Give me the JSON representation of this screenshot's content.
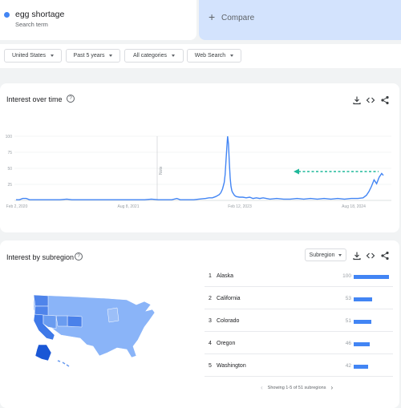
{
  "search": {
    "term": "egg shortage",
    "term_subtitle": "Search term",
    "term_color": "#4285f4",
    "compare_label": "Compare"
  },
  "filters": [
    {
      "label": "United States"
    },
    {
      "label": "Past 5 years"
    },
    {
      "label": "All categories"
    },
    {
      "label": "Web Search"
    }
  ],
  "interest_over_time": {
    "title": "Interest over time",
    "note_label": "Note"
  },
  "chart_data": {
    "type": "line",
    "x_tick_labels": [
      "Feb 2, 2020",
      "Aug 8, 2021",
      "Feb 12, 2023",
      "Aug 18, 2024"
    ],
    "y_tick_labels": [
      "100",
      "75",
      "50",
      "25"
    ],
    "ylim": [
      0,
      100
    ],
    "grid": true,
    "series": [
      {
        "color": "#4285f4",
        "points": [
          [
            0,
            1
          ],
          [
            4,
            1
          ],
          [
            8,
            3
          ],
          [
            12,
            3
          ],
          [
            16,
            1
          ],
          [
            24,
            1
          ],
          [
            32,
            1
          ],
          [
            40,
            1
          ],
          [
            52,
            1
          ],
          [
            60,
            2
          ],
          [
            66,
            1
          ],
          [
            76,
            1
          ],
          [
            84,
            1
          ],
          [
            96,
            1
          ],
          [
            104,
            1
          ],
          [
            112,
            1
          ],
          [
            120,
            1
          ],
          [
            128,
            1
          ],
          [
            140,
            1
          ],
          [
            152,
            1
          ],
          [
            160,
            2
          ],
          [
            168,
            1
          ],
          [
            176,
            1
          ],
          [
            184,
            1
          ],
          [
            190,
            3
          ],
          [
            194,
            1
          ],
          [
            200,
            1
          ],
          [
            210,
            1
          ],
          [
            216,
            2
          ],
          [
            224,
            3
          ],
          [
            228,
            4
          ],
          [
            232,
            4
          ],
          [
            236,
            6
          ],
          [
            240,
            9
          ],
          [
            242,
            12
          ],
          [
            244,
            18
          ],
          [
            246,
            28
          ],
          [
            247,
            40
          ],
          [
            248,
            60
          ],
          [
            249,
            82
          ],
          [
            250,
            100
          ],
          [
            251,
            88
          ],
          [
            252,
            60
          ],
          [
            253,
            35
          ],
          [
            254,
            22
          ],
          [
            255,
            15
          ],
          [
            256,
            12
          ],
          [
            258,
            8
          ],
          [
            260,
            6
          ],
          [
            264,
            5
          ],
          [
            268,
            5
          ],
          [
            272,
            4
          ],
          [
            276,
            5
          ],
          [
            280,
            3
          ],
          [
            284,
            4
          ],
          [
            288,
            3
          ],
          [
            292,
            4
          ],
          [
            300,
            2
          ],
          [
            308,
            3
          ],
          [
            316,
            2
          ],
          [
            324,
            2
          ],
          [
            332,
            3
          ],
          [
            340,
            2
          ],
          [
            348,
            3
          ],
          [
            356,
            2
          ],
          [
            364,
            3
          ],
          [
            372,
            2
          ],
          [
            380,
            3
          ],
          [
            388,
            2
          ],
          [
            396,
            3
          ],
          [
            404,
            3
          ],
          [
            410,
            4
          ],
          [
            414,
            8
          ],
          [
            417,
            14
          ],
          [
            420,
            22
          ],
          [
            423,
            32
          ],
          [
            426,
            26
          ],
          [
            429,
            36
          ],
          [
            432,
            42
          ],
          [
            434,
            39
          ]
        ]
      }
    ],
    "annotation": {
      "type": "dashed-arrow",
      "color": "#1fb89a",
      "direction": "left"
    }
  },
  "interest_by_subregion": {
    "title": "Interest by subregion",
    "dropdown_label": "Subregion",
    "rows": [
      {
        "rank": "1",
        "name": "Alaska",
        "value": 100
      },
      {
        "rank": "2",
        "name": "California",
        "value": 53
      },
      {
        "rank": "3",
        "name": "Colorado",
        "value": 51
      },
      {
        "rank": "4",
        "name": "Oregon",
        "value": 46
      },
      {
        "rank": "5",
        "name": "Washington",
        "value": 42
      }
    ],
    "pager_text": "Showing 1-5 of 51 subregions"
  },
  "icons": {
    "download": "download-icon",
    "embed": "embed-icon",
    "share": "share-icon",
    "help": "help-icon"
  }
}
